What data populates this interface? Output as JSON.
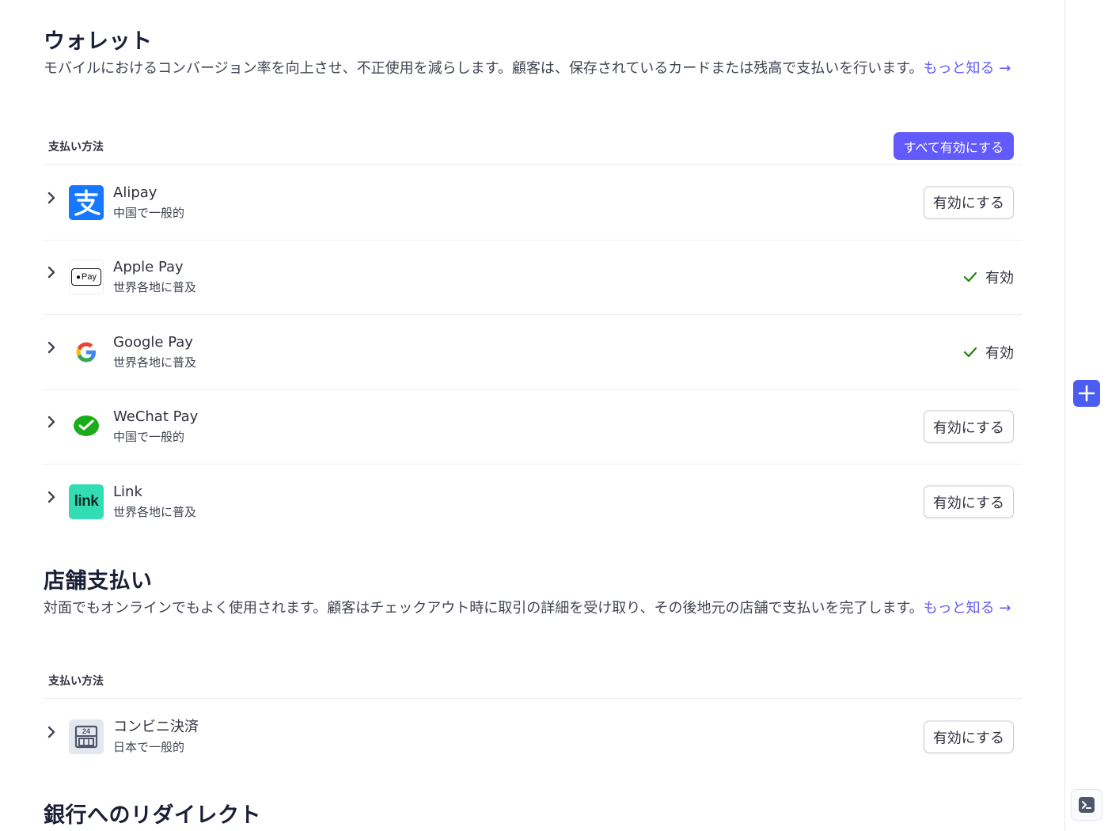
{
  "wallets": {
    "title": "ウォレット",
    "description": "モバイルにおけるコンバージョン率を向上させ、不正使用を減らします。顧客は、保存されているカードまたは残高で支払いを行います。",
    "learn_more": "もっと知る →",
    "column_label": "支払い方法",
    "enable_all_label": "すべて有効にする",
    "methods": [
      {
        "name": "Alipay",
        "region": "中国で一般的",
        "icon": "alipay-icon",
        "state": "enable_button",
        "action_label": "有効にする"
      },
      {
        "name": "Apple Pay",
        "region": "世界各地に普及",
        "icon": "apple-pay-icon",
        "state": "enabled",
        "action_label": "有効"
      },
      {
        "name": "Google Pay",
        "region": "世界各地に普及",
        "icon": "google-icon",
        "state": "enabled",
        "action_label": "有効"
      },
      {
        "name": "WeChat Pay",
        "region": "中国で一般的",
        "icon": "wechat-icon",
        "state": "enable_button",
        "action_label": "有効にする"
      },
      {
        "name": "Link",
        "region": "世界各地に普及",
        "icon": "link-icon",
        "state": "enable_button",
        "action_label": "有効にする"
      }
    ],
    "apple_pay_badge": "Pay",
    "link_logo_text": "link"
  },
  "store_payments": {
    "title": "店舗支払い",
    "description": "対面でもオンラインでもよく使用されます。顧客はチェックアウト時に取引の詳細を受け取り、その後地元の店舗で支払いを完了します。",
    "learn_more": "もっと知る →",
    "column_label": "支払い方法",
    "methods": [
      {
        "name": "コンビニ決済",
        "region": "日本で一般的",
        "icon": "konbini-store-icon",
        "state": "enable_button",
        "action_label": "有効にする"
      }
    ],
    "konbini_badge": "24"
  },
  "bank_redirects": {
    "title": "銀行へのリダイレクト"
  },
  "colors": {
    "accent": "#625afa",
    "enabled_check": "#228403",
    "alipay": "#1677ff",
    "wechat": "#1aad19",
    "link": "#33ddb3"
  },
  "rail": {
    "add_icon": "plus-icon",
    "terminal_icon": "terminal-icon"
  }
}
